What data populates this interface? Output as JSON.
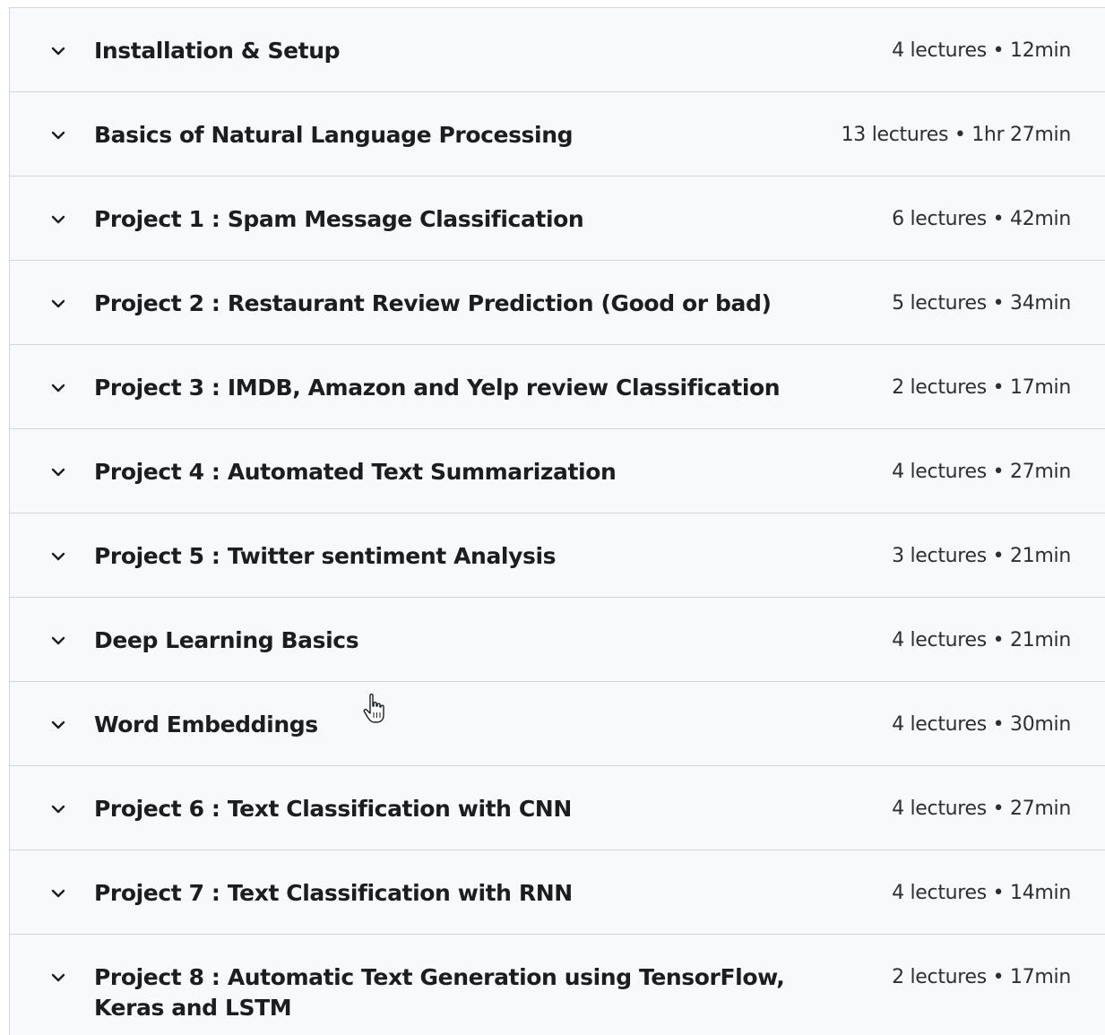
{
  "sections": [
    {
      "title": "Installation & Setup",
      "meta": "4 lectures • 12min"
    },
    {
      "title": "Basics of Natural Language Processing",
      "meta": "13 lectures • 1hr 27min"
    },
    {
      "title": "Project 1 : Spam Message Classification",
      "meta": "6 lectures • 42min"
    },
    {
      "title": "Project 2 : Restaurant Review Prediction (Good or bad)",
      "meta": "5 lectures • 34min"
    },
    {
      "title": "Project 3 : IMDB, Amazon and Yelp review Classification",
      "meta": "2 lectures • 17min"
    },
    {
      "title": "Project 4 : Automated Text Summarization",
      "meta": "4 lectures • 27min"
    },
    {
      "title": "Project 5 : Twitter sentiment Analysis",
      "meta": "3 lectures • 21min"
    },
    {
      "title": "Deep Learning Basics",
      "meta": "4 lectures • 21min"
    },
    {
      "title": "Word Embeddings",
      "meta": "4 lectures • 30min"
    },
    {
      "title": "Project 6 : Text Classification with CNN",
      "meta": "4 lectures • 27min"
    },
    {
      "title": "Project 7 : Text Classification with RNN",
      "meta": "4 lectures • 14min"
    },
    {
      "title": "Project 8 : Automatic Text Generation using TensorFlow, Keras and LSTM",
      "meta": "2 lectures • 17min"
    }
  ],
  "icons": {
    "expand": "chevron-down-icon",
    "cursor": "hand-pointer-cursor"
  },
  "colors": {
    "row_background": "#f7f9fa",
    "border": "#d1d7dc",
    "text": "#1c1d1f"
  }
}
